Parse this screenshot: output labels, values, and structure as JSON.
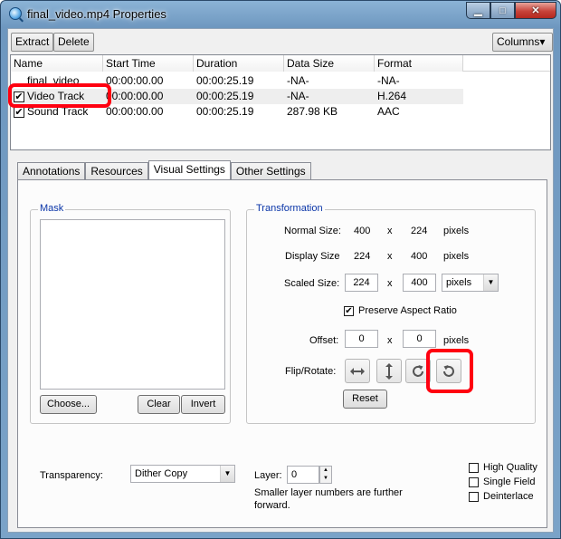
{
  "window": {
    "title": "final_video.mp4 Properties",
    "minimize_glyph": "▁",
    "maximize_glyph": "□",
    "close_glyph": "✕"
  },
  "toolbar": {
    "extract_label": "Extract",
    "delete_label": "Delete",
    "columns_label": "Columns▾"
  },
  "tracks": {
    "columns": [
      "Name",
      "Start Time",
      "Duration",
      "Data Size",
      "Format"
    ],
    "rows": [
      {
        "name": "final_video",
        "checked": false,
        "start": "00:00:00.00",
        "duration": "00:00:25.19",
        "size": "-NA-",
        "format": "-NA-"
      },
      {
        "name": "Video Track",
        "checked": true,
        "start": "00:00:00.00",
        "duration": "00:00:25.19",
        "size": "-NA-",
        "format": "H.264"
      },
      {
        "name": "Sound Track",
        "checked": true,
        "start": "00:00:00.00",
        "duration": "00:00:25.19",
        "size": "287.98 KB",
        "format": "AAC"
      }
    ],
    "check_glyph": "✔"
  },
  "tabs": [
    "Annotations",
    "Resources",
    "Visual Settings",
    "Other Settings"
  ],
  "active_tab": "Visual Settings",
  "mask": {
    "title": "Mask",
    "choose_label": "Choose...",
    "clear_label": "Clear",
    "invert_label": "Invert"
  },
  "transformation": {
    "title": "Transformation",
    "normal_size_label": "Normal Size:",
    "normal_w": "400",
    "normal_h": "224",
    "display_size_label": "Display Size",
    "display_w": "224",
    "display_h": "400",
    "scaled_size_label": "Scaled Size:",
    "scaled_w": "224",
    "scaled_h": "400",
    "times": "x",
    "pixels": "pixels",
    "units_value": "pixels",
    "preserve_label": "Preserve Aspect Ratio",
    "preserve_checked": true,
    "offset_label": "Offset:",
    "offset_x": "0",
    "offset_y": "0",
    "flip_rotate_label": "Flip/Rotate:",
    "reset_label": "Reset"
  },
  "transparency": {
    "label": "Transparency:",
    "value": "Dither Copy"
  },
  "layer": {
    "label": "Layer:",
    "value": "0",
    "hint": "Smaller layer numbers are further forward."
  },
  "options": {
    "high_quality": "High Quality",
    "single_field": "Single Field",
    "deinterlace": "Deinterlace"
  },
  "colors": {
    "highlight": "#ff0010",
    "group_title": "#0a35a8"
  }
}
